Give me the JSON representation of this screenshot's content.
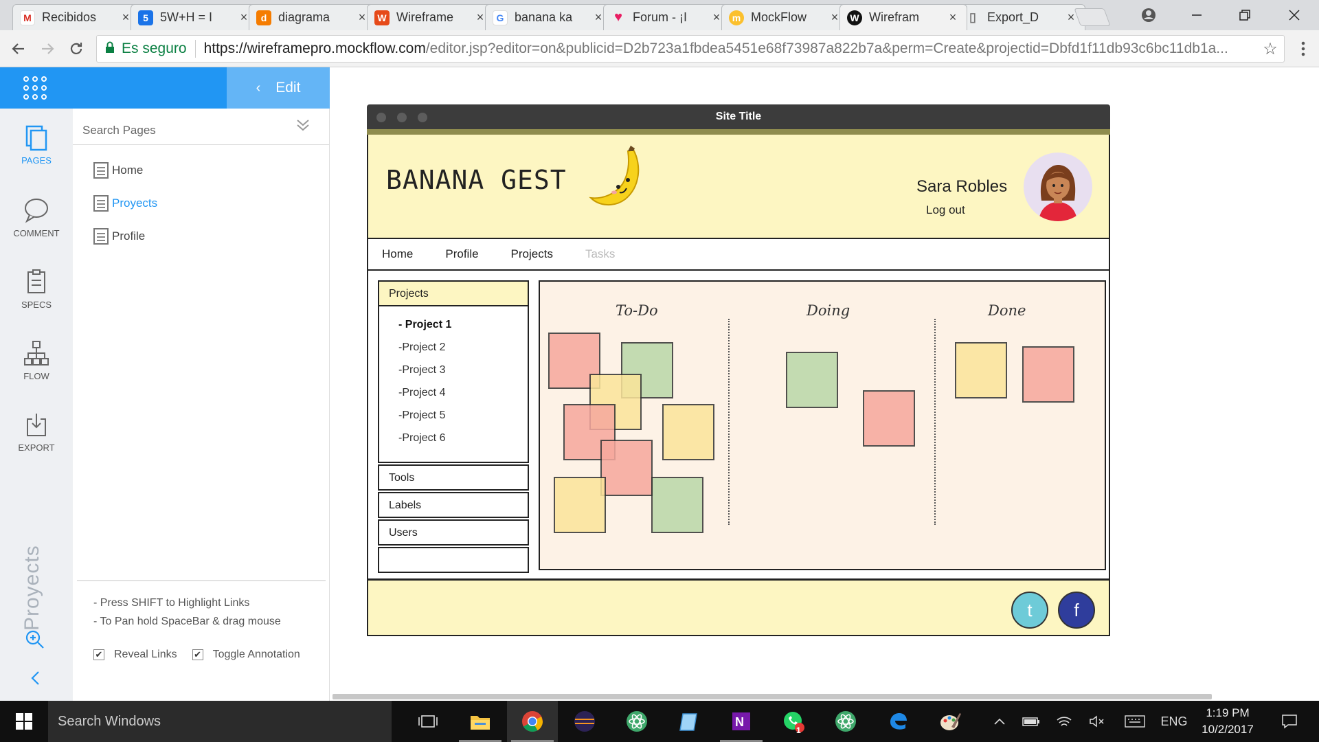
{
  "browser": {
    "tabs": [
      {
        "title": "Recibidos",
        "icon": "gmail-icon",
        "color": "#d93025",
        "glyph": "M"
      },
      {
        "title": "5W+H = I",
        "icon": "app-icon",
        "color": "#1a73e8",
        "glyph": "5"
      },
      {
        "title": "diagrama",
        "icon": "diagram-icon",
        "color": "#f57c00",
        "glyph": "d"
      },
      {
        "title": "Wireframe",
        "icon": "wireframe-icon",
        "color": "#e64a19",
        "glyph": "W"
      },
      {
        "title": "banana ka",
        "icon": "google-icon",
        "color": "#4285f4",
        "glyph": "G"
      },
      {
        "title": "Forum - ¡I",
        "icon": "heart-icon",
        "color": "#e91e63",
        "glyph": "♥"
      },
      {
        "title": "MockFlow",
        "icon": "mockflow-icon",
        "color": "#fbc02d",
        "glyph": "m"
      },
      {
        "title": "Wirefram",
        "icon": "wireframepro-icon",
        "color": "#111111",
        "glyph": "W"
      },
      {
        "title": "Export_D",
        "icon": "document-icon",
        "color": "#888888",
        "glyph": "▯"
      }
    ],
    "close_glyph": "×",
    "secure_label": "Es seguro",
    "url_host": "https://wireframepro.mockflow.com",
    "url_rest": "/editor.jsp?editor=on&publicid=D2b723a1fbdea5451e68f73987a822b7a&perm=Create&projectid=Dbfd1f11db93c6bc11db1a..."
  },
  "editor": {
    "edit_label": "Edit",
    "rail": [
      {
        "label": "PAGES",
        "icon": "pages-icon"
      },
      {
        "label": "COMMENT",
        "icon": "comment-icon"
      },
      {
        "label": "SPECS",
        "icon": "specs-icon"
      },
      {
        "label": "FLOW",
        "icon": "flow-icon"
      },
      {
        "label": "EXPORT",
        "icon": "export-icon"
      }
    ],
    "project_name": "Proyects",
    "search_placeholder": "Search Pages",
    "pages": [
      "Home",
      "Proyects",
      "Profile"
    ],
    "hints": [
      "- Press SHIFT to Highlight Links",
      "- To Pan hold SpaceBar & drag mouse"
    ],
    "checkboxes": [
      {
        "label": "Reveal Links",
        "checked": true
      },
      {
        "label": "Toggle Annotation",
        "checked": true
      }
    ]
  },
  "wireframe": {
    "site_title": "Site Title",
    "logo": "BANANA GEST",
    "user_name": "Sara Robles",
    "logout": "Log out",
    "nav": [
      "Home",
      "Profile",
      "Projects",
      "Tasks"
    ],
    "sidebar_header": "Projects",
    "projects": [
      "- Project 1",
      "-Project 2",
      "-Project 3",
      "-Project 4",
      "-Project 5",
      "-Project 6"
    ],
    "sidebar_rows": [
      "Tools",
      "Labels",
      "Users"
    ],
    "columns": [
      "To-Do",
      "Doing",
      "Done"
    ],
    "social": [
      {
        "label": "t",
        "color": "#6ecbd8"
      },
      {
        "label": "f",
        "color": "#2f3d9c"
      }
    ],
    "colors": {
      "header": "#fdf6c2",
      "board": "#fdf2e6",
      "note_pink": "#f6a89d",
      "note_yellow": "#fbe59a",
      "note_green": "#b9d8a8"
    }
  },
  "taskbar": {
    "search_placeholder": "Search Windows",
    "language": "ENG",
    "time": "1:19 PM",
    "date": "10/2/2017",
    "whatsapp_badge": "1"
  }
}
